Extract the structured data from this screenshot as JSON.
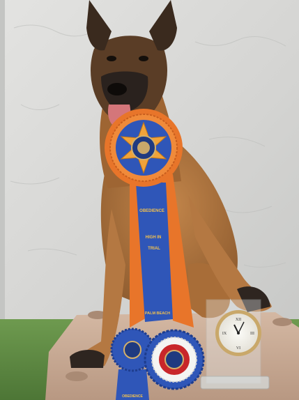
{
  "photo": {
    "description_free": true,
    "colors": {
      "wall": "#d9d9d7",
      "grass": "#5f8a45",
      "tray": "#c7a993",
      "dog_tan": "#b3773f",
      "dog_dark": "#2b2420",
      "ribbon_orange": "#e8752a",
      "ribbon_blue": "#2f56b8",
      "rosette_red": "#c8262a",
      "clock_gold": "#c9a86a"
    }
  },
  "ribbon": {
    "line1": "OBEDIENCE",
    "line2": "HIGH IN",
    "line3": "TRIAL",
    "line4": "PALM BEACH"
  },
  "small_ribbon": {
    "label": "OBEDIENCE"
  },
  "clock": {
    "numerals": [
      "XII",
      "III",
      "VI",
      "IX"
    ]
  }
}
